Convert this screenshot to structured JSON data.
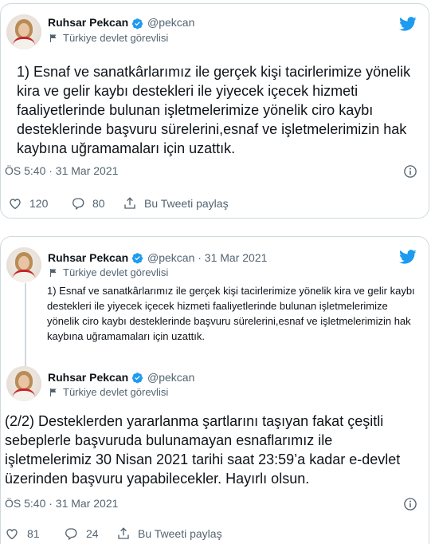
{
  "tweet1": {
    "author_name": "Ruhsar Pekcan",
    "handle": "@pekcan",
    "label": "Türkiye devlet görevlisi",
    "text": "1) Esnaf ve sanatkârlarımız ile gerçek kişi tacirlerimize yönelik kira ve gelir kaybı destekleri ile yiyecek içecek hizmeti faaliyetlerinde bulunan işletmelerimize yönelik ciro kaybı desteklerinde başvuru sürelerini,esnaf ve işletmelerimizin hak kaybına uğramamaları için uzattık.",
    "timestamp": "ÖS 5:40 · 31 Mar 2021",
    "likes": "120",
    "replies": "80",
    "share_label": "Bu Tweeti paylaş"
  },
  "tweet2": {
    "quoted": {
      "author_name": "Ruhsar Pekcan",
      "handle_date": "@pekcan · 31 Mar 2021",
      "label": "Türkiye devlet görevlisi",
      "text": "1) Esnaf ve sanatkârlarımız ile gerçek kişi tacirlerimize yönelik kira ve gelir kaybı destekleri ile yiyecek içecek hizmeti faaliyetlerinde bulunan işletmelerimize yönelik ciro kaybı desteklerinde başvuru sürelerini,esnaf ve işletmelerimizin hak kaybına uğramamaları için uzattık."
    },
    "author_name": "Ruhsar Pekcan",
    "handle": "@pekcan",
    "label": "Türkiye devlet görevlisi",
    "text": "(2/2) Desteklerden yararlanma şartlarını taşıyan fakat çeşitli sebeplerle başvuruda bulunamayan esnaflarımız ile işletmelerimiz 30 Nisan 2021 tarihi saat 23:59’a kadar e-devlet üzerinden başvuru yapabilecekler. Hayırlı olsun.",
    "timestamp": "ÖS 5:40 · 31 Mar 2021",
    "likes": "81",
    "replies": "24",
    "share_label": "Bu Tweeti paylaş"
  },
  "colors": {
    "twitter_blue": "#1d9bf0",
    "secondary_text": "#536471",
    "border": "#cfd9de"
  },
  "icons": [
    "twitter-bird-icon",
    "verified-badge-icon",
    "flag-icon",
    "info-icon",
    "heart-icon",
    "reply-icon",
    "share-icon"
  ]
}
